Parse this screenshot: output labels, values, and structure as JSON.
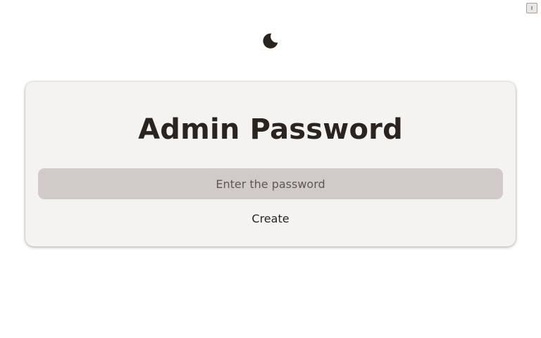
{
  "top_corner": {
    "icon": "small-square-icon",
    "glyph": "▯"
  },
  "theme_toggle": {
    "icon": "moon-icon"
  },
  "card": {
    "title": "Admin Password",
    "password_placeholder": "Enter the password",
    "password_value": "",
    "create_label": "Create"
  },
  "colors": {
    "page_background": "#ffffff",
    "card_background": "#f5f3f1",
    "input_background": "#d0cbc8",
    "text": "#2a2421",
    "placeholder": "#5e5754"
  }
}
